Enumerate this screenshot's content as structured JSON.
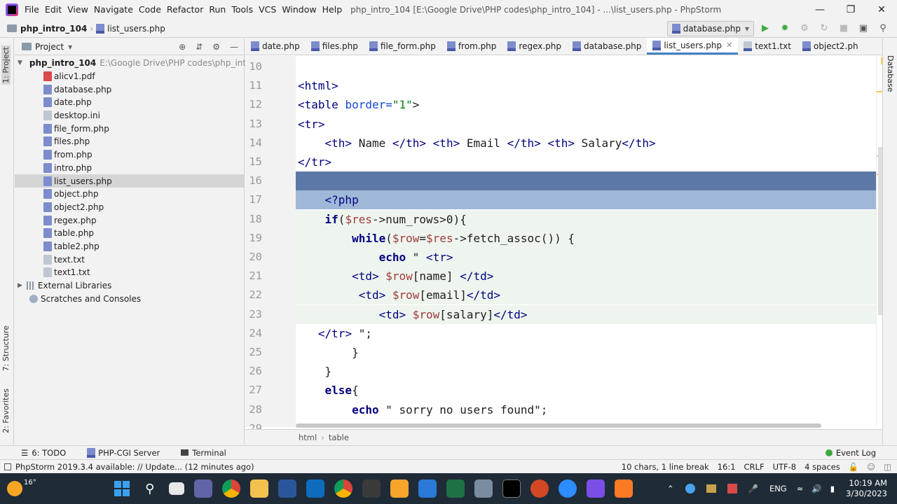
{
  "menubar": {
    "items": [
      {
        "label": "File"
      },
      {
        "label": "Edit"
      },
      {
        "label": "View"
      },
      {
        "label": "Navigate"
      },
      {
        "label": "Code"
      },
      {
        "label": "Refactor"
      },
      {
        "label": "Run"
      },
      {
        "label": "Tools"
      },
      {
        "label": "VCS"
      },
      {
        "label": "Window"
      },
      {
        "label": "Help"
      }
    ],
    "window_title": "php_intro_104 [E:\\Google Drive\\PHP codes\\php_intro_104] - ...\\list_users.php - PhpStorm"
  },
  "navbar": {
    "project": "php_intro_104",
    "file": "list_users.php",
    "run_config": "database.php"
  },
  "left_strip": {
    "project_tab": "1: Project",
    "structure_tab": "7: Structure",
    "favorites_tab": "2: Favorites"
  },
  "project_panel": {
    "title": "Project",
    "root": {
      "name": "php_intro_104",
      "path": "E:\\Google Drive\\PHP codes\\php_intro_104"
    },
    "files": [
      {
        "name": "alicv1.pdf",
        "type": "pdf"
      },
      {
        "name": "database.php",
        "type": "php"
      },
      {
        "name": "date.php",
        "type": "php"
      },
      {
        "name": "desktop.ini",
        "type": "ini"
      },
      {
        "name": "file_form.php",
        "type": "php"
      },
      {
        "name": "files.php",
        "type": "php"
      },
      {
        "name": "from.php",
        "type": "php"
      },
      {
        "name": "intro.php",
        "type": "php"
      },
      {
        "name": "list_users.php",
        "type": "php",
        "selected": true
      },
      {
        "name": "object.php",
        "type": "php"
      },
      {
        "name": "object2.php",
        "type": "php"
      },
      {
        "name": "regex.php",
        "type": "php"
      },
      {
        "name": "table.php",
        "type": "php"
      },
      {
        "name": "table2.php",
        "type": "php"
      },
      {
        "name": "text.txt",
        "type": "txt"
      },
      {
        "name": "text1.txt",
        "type": "txt"
      }
    ],
    "external": "External Libraries",
    "scratches": "Scratches and Consoles"
  },
  "tabs": [
    {
      "label": "date.php"
    },
    {
      "label": "files.php"
    },
    {
      "label": "file_form.php"
    },
    {
      "label": "from.php"
    },
    {
      "label": "regex.php"
    },
    {
      "label": "database.php"
    },
    {
      "label": "list_users.php",
      "active": true
    },
    {
      "label": "text1.txt"
    },
    {
      "label": "object2.ph"
    }
  ],
  "right_strip": {
    "database_tab": "Database"
  },
  "editor": {
    "lines": [
      {
        "n": "10",
        "text": ""
      },
      {
        "n": "11",
        "text": "<html>"
      },
      {
        "n": "12",
        "text": "<table border=\"1\">"
      },
      {
        "n": "13",
        "text": "<tr>"
      },
      {
        "n": "14",
        "text": "    <th> Name </th> <th> Email </th> <th> Salary</th>"
      },
      {
        "n": "15",
        "text": "</tr>"
      },
      {
        "n": "16",
        "text": ""
      },
      {
        "n": "17",
        "text": "    <?php"
      },
      {
        "n": "18",
        "text": "    if($res->num_rows>0){"
      },
      {
        "n": "19",
        "text": "        while($row=$res->fetch_assoc()) {"
      },
      {
        "n": "20",
        "text": "            echo \" <tr>"
      },
      {
        "n": "21",
        "text": "        <td> $row[name] </td>"
      },
      {
        "n": "22",
        "text": "         <td> $row[email]</td>"
      },
      {
        "n": "23",
        "text": "            <td> $row[salary]</td>"
      },
      {
        "n": "24",
        "text": "   </tr> \";"
      },
      {
        "n": "25",
        "text": "        }"
      },
      {
        "n": "26",
        "text": "    }"
      },
      {
        "n": "27",
        "text": "    else{"
      },
      {
        "n": "28",
        "text": "        echo \" sorry no users found\";"
      },
      {
        "n": "29",
        "text": "    }"
      }
    ],
    "breadcrumb": [
      "html",
      "table"
    ]
  },
  "bottom_tools": [
    {
      "label": "6: TODO"
    },
    {
      "label": "PHP-CGI Server"
    },
    {
      "label": "Terminal"
    }
  ],
  "event_log": "Event Log",
  "status": {
    "message": "PhpStorm 2019.3.4 available: // Update... (12 minutes ago)",
    "selection": "10 chars, 1 line break",
    "position": "16:1",
    "line_sep": "CRLF",
    "encoding": "UTF-8",
    "indent": "4 spaces"
  },
  "taskbar": {
    "weather": "16°",
    "lang": "ENG",
    "time": "10:19 AM",
    "date": "3/30/2023"
  }
}
